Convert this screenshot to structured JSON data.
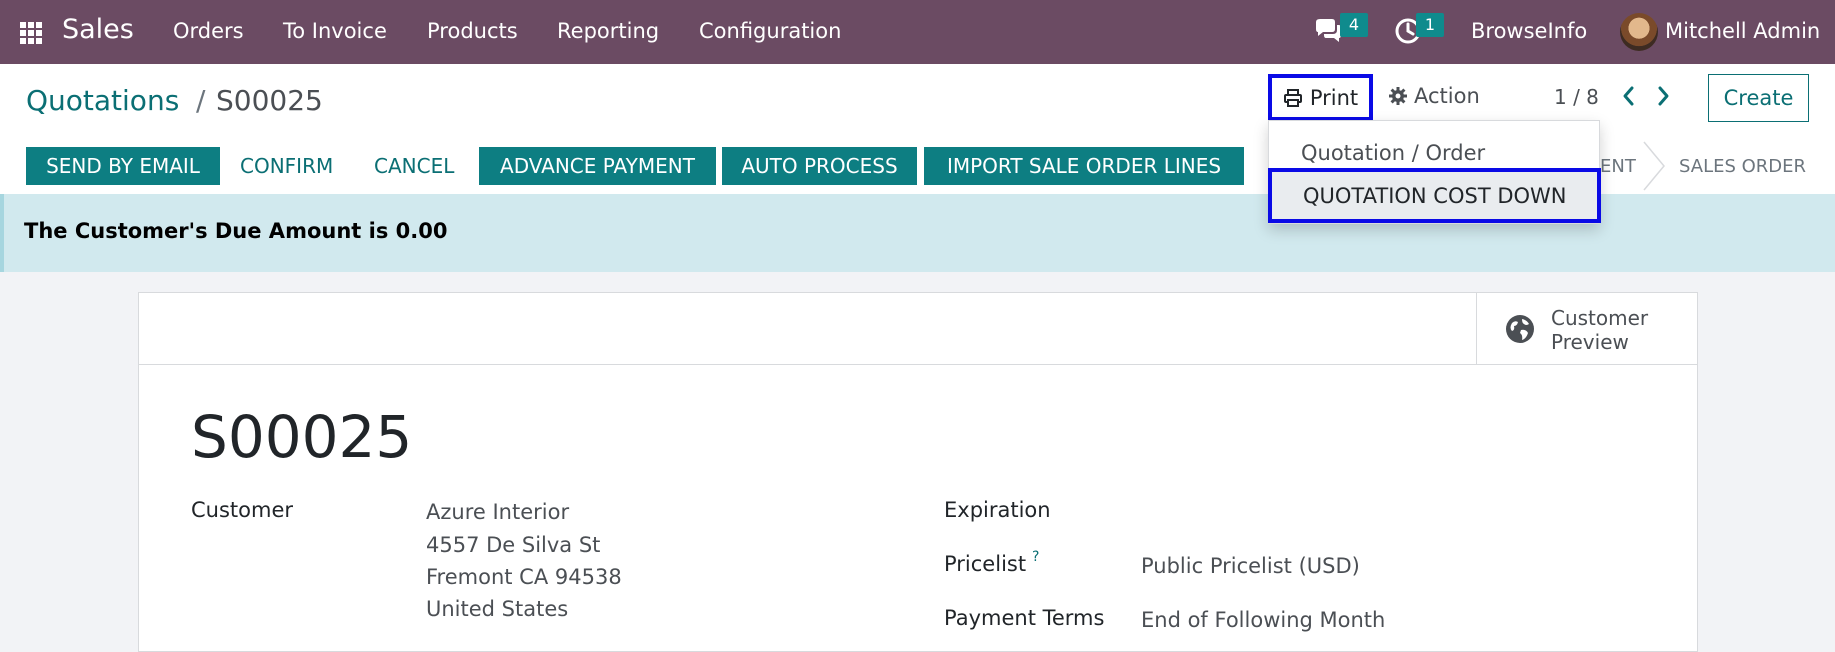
{
  "navbar": {
    "app_name": "Sales",
    "menu": [
      "Orders",
      "To Invoice",
      "Products",
      "Reporting",
      "Configuration"
    ],
    "messages_count": "4",
    "activities_count": "1",
    "company": "BrowseInfo",
    "user": "Mitchell Admin"
  },
  "breadcrumb": {
    "parent": "Quotations",
    "separator": "/",
    "current": "S00025"
  },
  "toolbar": {
    "print_label": "Print",
    "action_label": "Action",
    "pager": "1 / 8",
    "create_label": "Create"
  },
  "print_menu": {
    "items": [
      "Quotation / Order",
      "QUOTATION COST DOWN"
    ]
  },
  "status_buttons": {
    "send_by_email": "SEND BY EMAIL",
    "confirm": "CONFIRM",
    "cancel": "CANCEL",
    "advance_payment": "ADVANCE PAYMENT",
    "auto_process": "AUTO PROCESS",
    "import_lines": "IMPORT SALE ORDER LINES"
  },
  "statusbar": {
    "partial_stage": "ENT",
    "sales_order": "SALES ORDER"
  },
  "alert": {
    "text": "The Customer's Due Amount is 0.00"
  },
  "button_box": {
    "customer_preview": "Customer Preview"
  },
  "form": {
    "name": "S00025",
    "customer_label": "Customer",
    "customer_address": [
      "Azure Interior",
      "4557 De Silva St",
      "Fremont CA 94538",
      "United States"
    ],
    "expiration_label": "Expiration",
    "pricelist_label": "Pricelist",
    "pricelist_help": "?",
    "pricelist_value": "Public Pricelist (USD)",
    "payment_terms_label": "Payment Terms",
    "payment_terms_value": "End of Following Month"
  },
  "icons": {
    "apps": "apps-grid-icon",
    "messages": "chat-icon",
    "activities": "clock-icon",
    "print": "printer-icon",
    "action": "gear-icon",
    "prev": "chevron-left-icon",
    "next": "chevron-right-icon",
    "preview": "globe-icon"
  },
  "colors": {
    "navbar": "#6b4b63",
    "primary": "#0d7e82",
    "link": "#0b6f74",
    "highlight_border": "#0a0ae6",
    "alert_bg": "#d1e9ee"
  }
}
